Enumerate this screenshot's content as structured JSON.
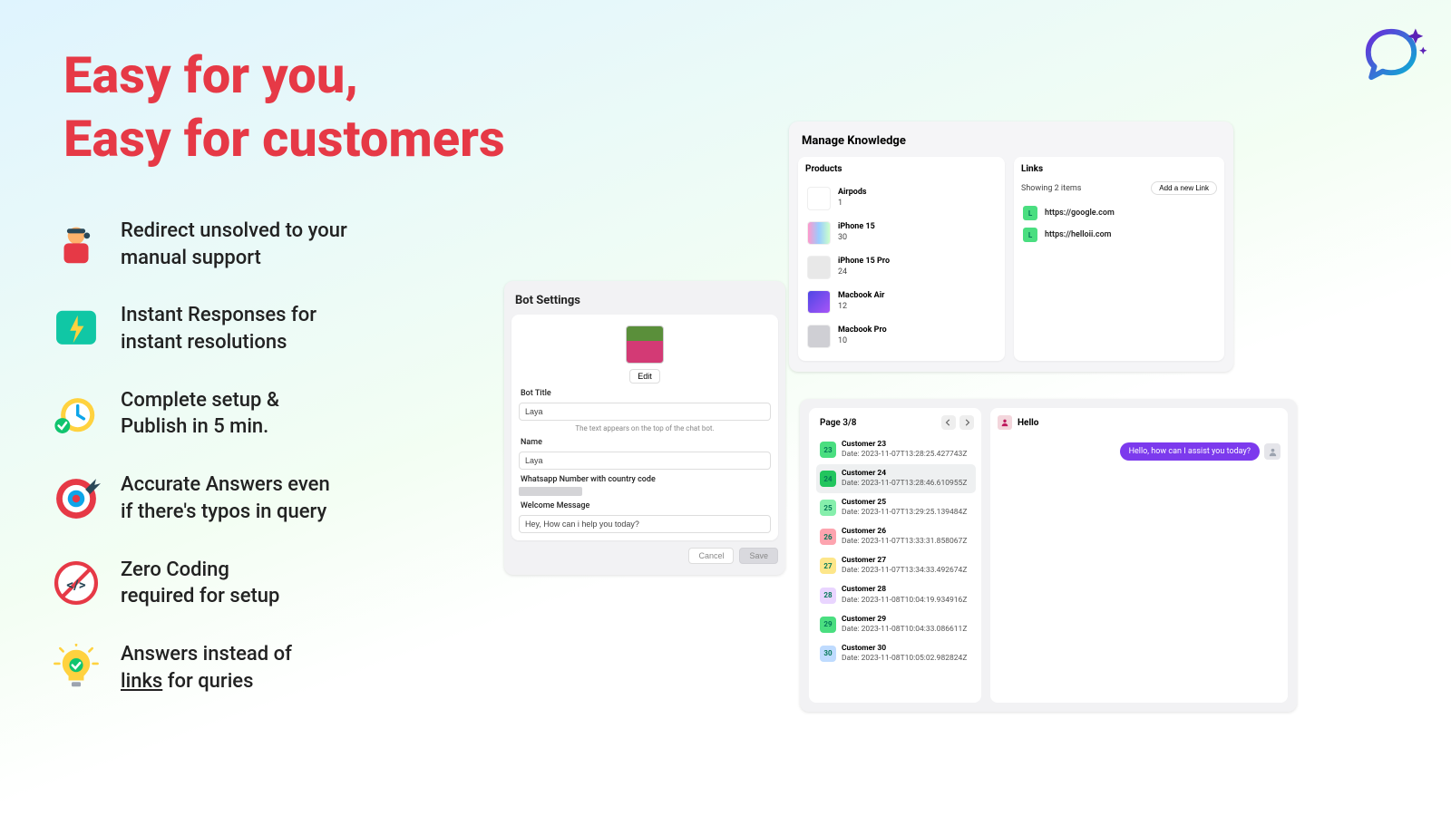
{
  "headline": {
    "line1": "Easy for you,",
    "line2": "Easy for customers"
  },
  "features": [
    {
      "icon": "support-agent-icon",
      "line1": "Redirect unsolved to your",
      "line2": "manual support"
    },
    {
      "icon": "lightning-icon",
      "line1": "Instant Responses for",
      "line2": "instant resolutions"
    },
    {
      "icon": "clock-check-icon",
      "line1": "Complete setup &",
      "line2": "Publish in 5 min."
    },
    {
      "icon": "target-icon",
      "line1": "Accurate Answers even",
      "line2": "if there's typos in query"
    },
    {
      "icon": "no-code-icon",
      "line1": "Zero Coding",
      "line2": "required for setup"
    },
    {
      "icon": "idea-check-icon",
      "line1_pre": "Answers instead of",
      "line2_underline": "links",
      "line2_post": " for quries"
    }
  ],
  "bot_settings": {
    "title": "Bot Settings",
    "edit": "Edit",
    "fields": {
      "bot_title_label": "Bot Title",
      "bot_title_value": "Laya",
      "hint": "The text appears on the top of the chat bot.",
      "name_label": "Name",
      "name_value": "Laya",
      "whatsapp_label": "Whatsapp Number with country code",
      "welcome_label": "Welcome Message",
      "welcome_value": "Hey, How can i help you today?"
    },
    "cancel": "Cancel",
    "save": "Save"
  },
  "knowledge": {
    "title": "Manage Knowledge",
    "products_title": "Products",
    "products": [
      {
        "name": "Airpods",
        "count": "1"
      },
      {
        "name": "iPhone 15",
        "count": "30"
      },
      {
        "name": "iPhone 15 Pro",
        "count": "24"
      },
      {
        "name": "Macbook Air",
        "count": "12"
      },
      {
        "name": "Macbook Pro",
        "count": "10"
      }
    ],
    "links_title": "Links",
    "links_showing": "Showing 2 items",
    "add_link": "Add a new Link",
    "links": [
      {
        "badge": "L",
        "url": "https://google.com"
      },
      {
        "badge": "L",
        "url": "https://helloii.com"
      }
    ]
  },
  "inbox": {
    "page": "Page 3/8",
    "customers": [
      {
        "num": "23",
        "color": "#4ade80",
        "name": "Customer 23",
        "date": "Date: 2023-11-07T13:28:25.427743Z"
      },
      {
        "num": "24",
        "color": "#22c55e",
        "name": "Customer 24",
        "date": "Date: 2023-11-07T13:28:46.610955Z",
        "selected": true
      },
      {
        "num": "25",
        "color": "#86efac",
        "name": "Customer 25",
        "date": "Date: 2023-11-07T13:29:25.139484Z"
      },
      {
        "num": "26",
        "color": "#fda4af",
        "name": "Customer 26",
        "date": "Date: 2023-11-07T13:33:31.858067Z"
      },
      {
        "num": "27",
        "color": "#fde68a",
        "name": "Customer 27",
        "date": "Date: 2023-11-07T13:34:33.492674Z"
      },
      {
        "num": "28",
        "color": "#e9d5ff",
        "name": "Customer 28",
        "date": "Date: 2023-11-08T10:04:19.934916Z"
      },
      {
        "num": "29",
        "color": "#4ade80",
        "name": "Customer 29",
        "date": "Date: 2023-11-08T10:04:33.086611Z"
      },
      {
        "num": "30",
        "color": "#bfdbfe",
        "name": "Customer 30",
        "date": "Date: 2023-11-08T10:05:02.982824Z"
      }
    ]
  },
  "chat": {
    "title": "Hello",
    "assistant_bubble": "Hello, how can I assist you today?"
  }
}
